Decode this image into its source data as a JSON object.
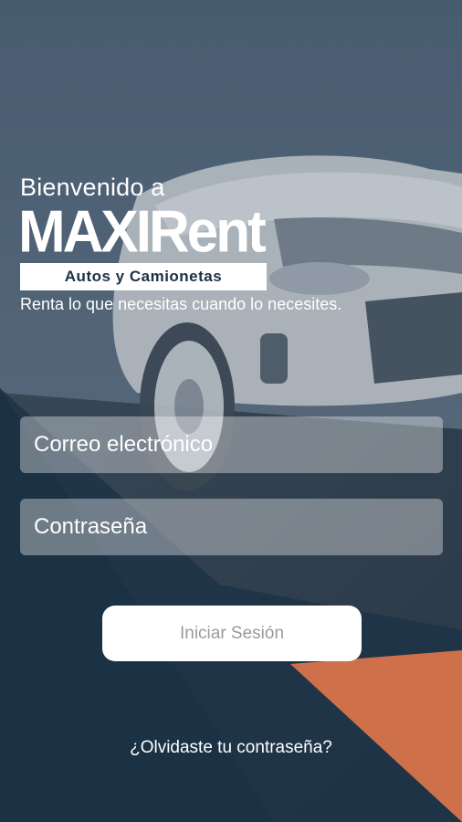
{
  "header": {
    "welcome": "Bienvenido a",
    "brand": "MAXIRent",
    "brand_sub": "Autos y Camionetas",
    "tagline": "Renta lo que necesitas cuando lo necesites."
  },
  "form": {
    "email_placeholder": "Correo electrónico",
    "password_placeholder": "Contraseña",
    "login_button": "Iniciar Sesión",
    "forgot_link": "¿Olvidaste tu contraseña?"
  },
  "colors": {
    "navy": "#1d3447",
    "slate": "#4d6173",
    "accent": "#e6794a",
    "white": "#ffffff"
  }
}
